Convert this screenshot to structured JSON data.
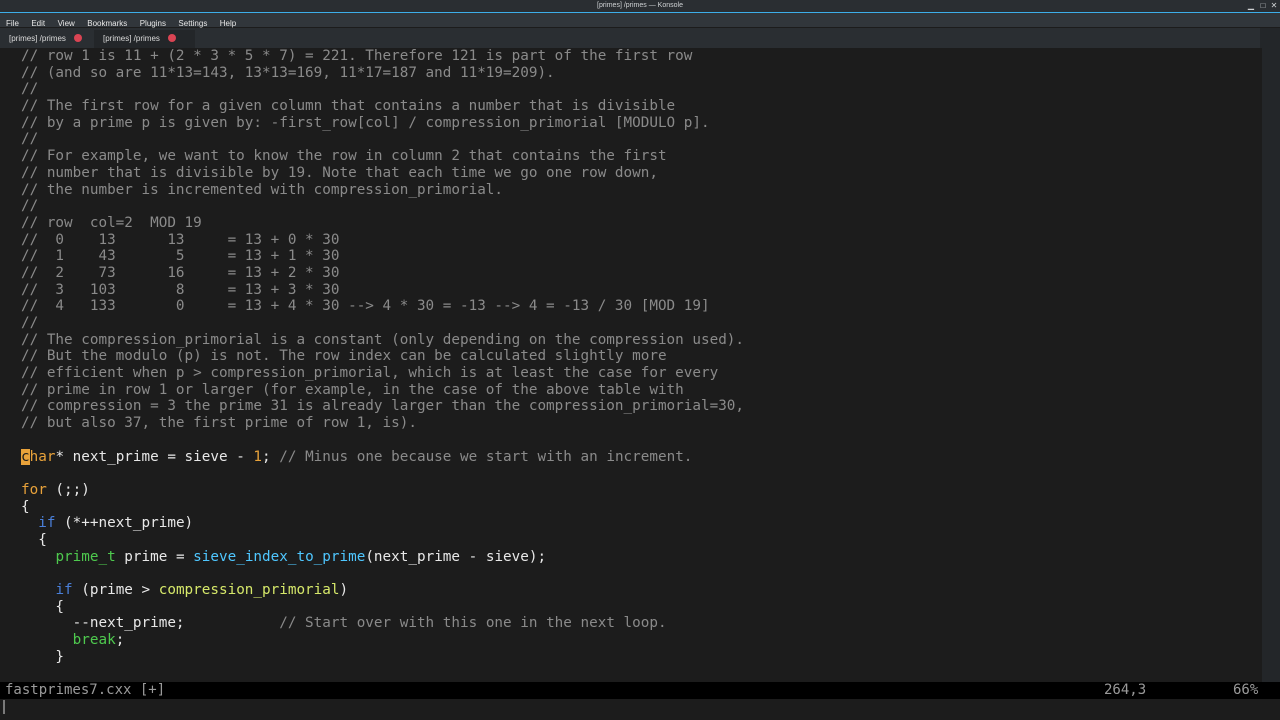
{
  "window": {
    "title": "[primes] /primes — Konsole"
  },
  "menu": [
    "File",
    "Edit",
    "View",
    "Bookmarks",
    "Plugins",
    "Settings",
    "Help"
  ],
  "tabs": [
    {
      "label": "[primes] /primes",
      "active": false
    },
    {
      "label": "[primes] /primes",
      "active": true
    }
  ],
  "code_lines": [
    [
      {
        "t": "// row 1 is 11 + (2 * 3 * 5 * 7) = 221. Therefore 121 is part of the first row",
        "c": "cm"
      }
    ],
    [
      {
        "t": "// (and so are 11*13=143, 13*13=169, 11*17=187 and 11*19=209).",
        "c": "cm"
      }
    ],
    [
      {
        "t": "//",
        "c": "cm"
      }
    ],
    [
      {
        "t": "// The first row for a given column that contains a number that is divisible",
        "c": "cm"
      }
    ],
    [
      {
        "t": "// by a prime p is given by: -first_row[col] / compression_primorial [MODULO p].",
        "c": "cm"
      }
    ],
    [
      {
        "t": "//",
        "c": "cm"
      }
    ],
    [
      {
        "t": "// For example, we want to know the row in column 2 that contains the first",
        "c": "cm"
      }
    ],
    [
      {
        "t": "// number that is divisible by 19. Note that each time we go one row down,",
        "c": "cm"
      }
    ],
    [
      {
        "t": "// the number is incremented with compression_primorial.",
        "c": "cm"
      }
    ],
    [
      {
        "t": "//",
        "c": "cm"
      }
    ],
    [
      {
        "t": "// row  col=2  MOD 19",
        "c": "cm"
      }
    ],
    [
      {
        "t": "//  0    13      13     = 13 + 0 * 30",
        "c": "cm"
      }
    ],
    [
      {
        "t": "//  1    43       5     = 13 + 1 * 30",
        "c": "cm"
      }
    ],
    [
      {
        "t": "//  2    73      16     = 13 + 2 * 30",
        "c": "cm"
      }
    ],
    [
      {
        "t": "//  3   103       8     = 13 + 3 * 30",
        "c": "cm"
      }
    ],
    [
      {
        "t": "//  4   133       0     = 13 + 4 * 30 --> 4 * 30 = -13 --> 4 = -13 / 30 [MOD 19]",
        "c": "cm"
      }
    ],
    [
      {
        "t": "//",
        "c": "cm"
      }
    ],
    [
      {
        "t": "// The compression_primorial is a constant (only depending on the compression used).",
        "c": "cm"
      }
    ],
    [
      {
        "t": "// But the modulo (p) is not. The row index can be calculated slightly more",
        "c": "cm"
      }
    ],
    [
      {
        "t": "// efficient when p > compression_primorial, which is at least the case for every",
        "c": "cm"
      }
    ],
    [
      {
        "t": "// prime in row 1 or larger (for example, in the case of the above table with",
        "c": "cm"
      }
    ],
    [
      {
        "t": "// compression = 3 the prime 31 is already larger than the compression_primorial=30,",
        "c": "cm"
      }
    ],
    [
      {
        "t": "// but also 37, the first prime of row 1, is).",
        "c": "cm"
      }
    ],
    [],
    [
      {
        "t": "c",
        "c": "cursor"
      },
      {
        "t": "har",
        "c": "kw"
      },
      {
        "t": "* next_prime = sieve - ",
        "c": ""
      },
      {
        "t": "1",
        "c": "num"
      },
      {
        "t": "; ",
        "c": ""
      },
      {
        "t": "// Minus one because we start with an increment.",
        "c": "cm"
      }
    ],
    [],
    [
      {
        "t": "for",
        "c": "kw"
      },
      {
        "t": " (;;)",
        "c": ""
      }
    ],
    [
      {
        "t": "{",
        "c": ""
      }
    ],
    [
      {
        "t": "  ",
        "c": ""
      },
      {
        "t": "if",
        "c": "kw2"
      },
      {
        "t": " (*++next_prime)",
        "c": ""
      }
    ],
    [
      {
        "t": "  {",
        "c": ""
      }
    ],
    [
      {
        "t": "    ",
        "c": ""
      },
      {
        "t": "prime_t",
        "c": "ty"
      },
      {
        "t": " prime = ",
        "c": ""
      },
      {
        "t": "sieve_index_to_prime",
        "c": "fn"
      },
      {
        "t": "(next_prime - sieve);",
        "c": ""
      }
    ],
    [],
    [
      {
        "t": "    ",
        "c": ""
      },
      {
        "t": "if",
        "c": "kw2"
      },
      {
        "t": " (prime > ",
        "c": ""
      },
      {
        "t": "compression_primorial",
        "c": "id2"
      },
      {
        "t": ")",
        "c": ""
      }
    ],
    [
      {
        "t": "    {",
        "c": ""
      }
    ],
    [
      {
        "t": "      --next_prime;           ",
        "c": ""
      },
      {
        "t": "// Start over with this one in the next loop.",
        "c": "cm"
      }
    ],
    [
      {
        "t": "      ",
        "c": ""
      },
      {
        "t": "break",
        "c": "ty"
      },
      {
        "t": ";",
        "c": ""
      }
    ],
    [
      {
        "t": "    }",
        "c": ""
      }
    ]
  ],
  "status": {
    "filename": "fastprimes7.cxx [+]",
    "position": "264,3",
    "percent": "66%"
  }
}
